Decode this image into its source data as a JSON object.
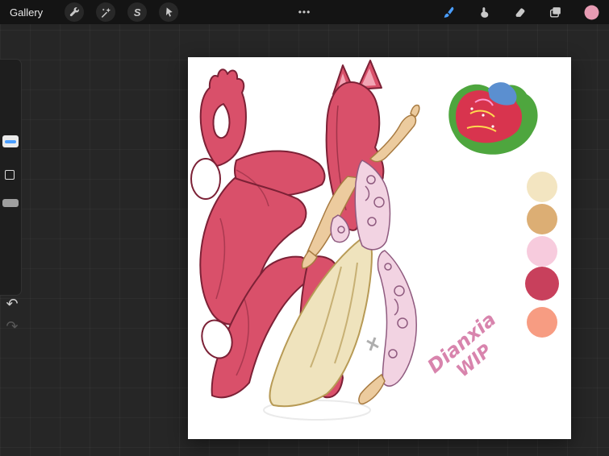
{
  "toolbar": {
    "gallery_label": "Gallery",
    "center_handle": "•••",
    "selection_glyph": "S",
    "accent_blue": "#4a9eff",
    "current_color": "#e79bb3",
    "icon_gray": "#c9c9c9"
  },
  "sidebar": {
    "undo_glyph": "↶",
    "redo_glyph": "↷"
  },
  "canvas": {
    "signature": {
      "line1": "Dianxia",
      "line2": "WIP",
      "color": "#d884ad"
    },
    "palette_swatches": [
      {
        "name": "cream",
        "color": "#f3e5c1"
      },
      {
        "name": "tan",
        "color": "#dcae74"
      },
      {
        "name": "light-pink",
        "color": "#f7cbdd"
      },
      {
        "name": "crimson",
        "color": "#c8405c"
      },
      {
        "name": "salmon",
        "color": "#f79c82"
      }
    ],
    "artwork_colors": {
      "fur": "#d9506a",
      "fur_outline": "#7c2136",
      "fur_inner_ear": "#f2a4b4",
      "skin": "#eccb9e",
      "skin_line": "#a87b42",
      "dress": "#efe3bd",
      "dress_line": "#b79a55",
      "ornament": "#f2d3e2",
      "ornament_line": "#8f5b7f",
      "sketch_gray": "#9a9a9a"
    },
    "texture_swatch": {
      "green": "#4ea63e",
      "red": "#d8344e",
      "blue": "#5b8fd0",
      "yellow": "#ffd94f",
      "pink": "#ff9ad1"
    }
  }
}
